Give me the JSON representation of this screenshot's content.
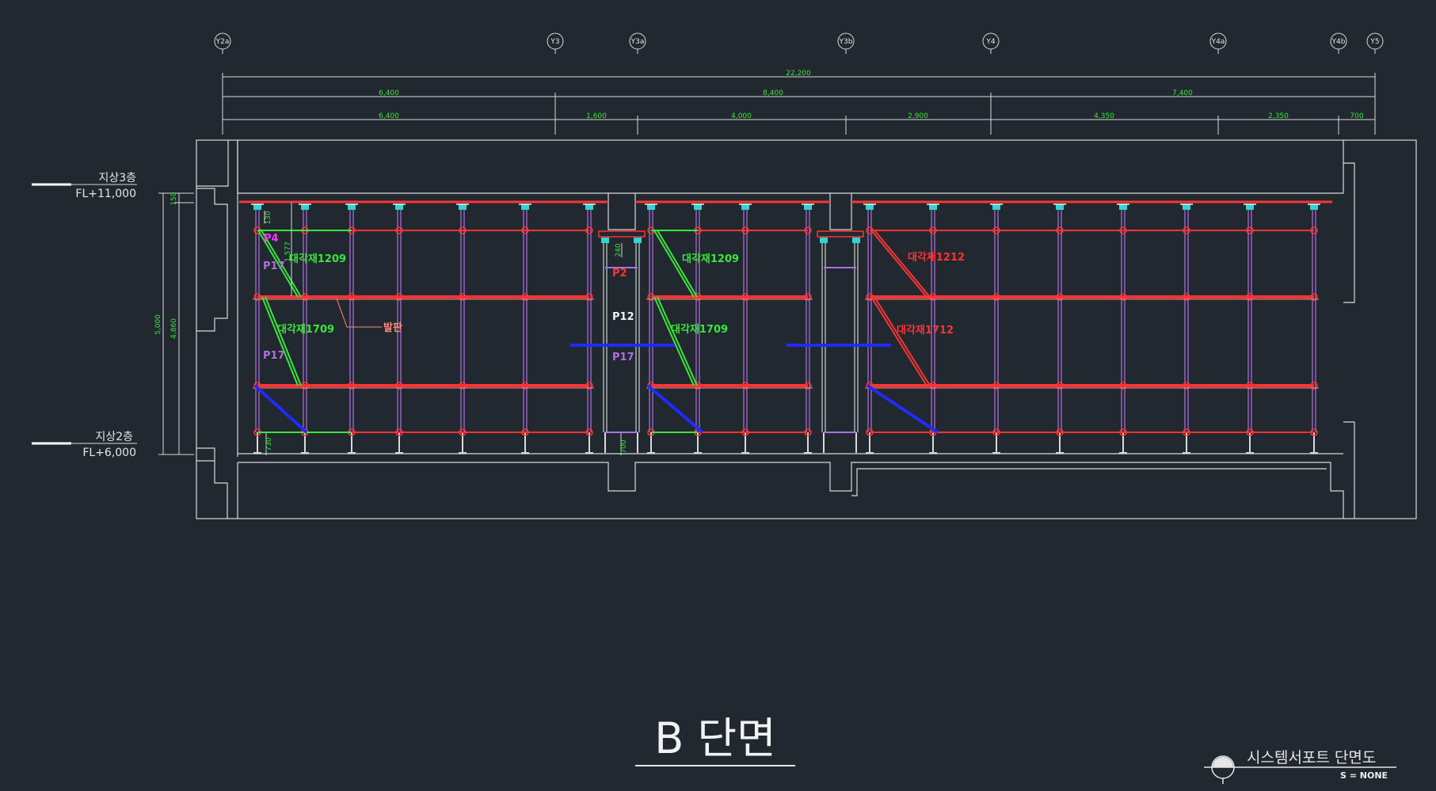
{
  "colors": {
    "background": "#212830",
    "outline": "#d9d9d9",
    "dimension": "#39e639",
    "support_red": "#ff3333",
    "support_green": "#39e639",
    "support_purple": "#b070e0",
    "brace_blue": "#1f2bff",
    "jack_cyan": "#2fd4d4"
  },
  "grid_axes": [
    "Y2a",
    "Y3",
    "Y3a",
    "Y3b",
    "Y4",
    "Y4a",
    "Y4b",
    "Y5"
  ],
  "dimensions": {
    "overall": "22,200",
    "tier2": [
      "6,400",
      "8,400",
      "7,400"
    ],
    "tier3": [
      "6,400",
      "1,600",
      "4,000",
      "2,900",
      "4,350",
      "2,350",
      "700"
    ],
    "vertical": [
      "5,000",
      "4,860",
      "150"
    ],
    "small": [
      "130",
      "1,577",
      "240",
      "730",
      "700"
    ]
  },
  "levels": {
    "upper": {
      "name": "지상3층",
      "fl": "FL+11,000"
    },
    "lower": {
      "name": "지상2층",
      "fl": "FL+6,000"
    }
  },
  "labels": {
    "brace_1209_left": "대각재1209",
    "brace_1709_left": "대각재1709",
    "brace_1209_mid": "대각재1209",
    "brace_1709_mid": "대각재1709",
    "brace_1212": "대각재1212",
    "brace_1712": "대각재1712",
    "balpan": "발판",
    "p4": "P4",
    "p17_a": "P17",
    "p17_b": "P17",
    "p2": "P2",
    "p12": "P12",
    "p17_mid": "P17"
  },
  "title": {
    "main": "B 단면",
    "subtitle": "시스템서포트 단면도",
    "scale": "S = NONE"
  }
}
